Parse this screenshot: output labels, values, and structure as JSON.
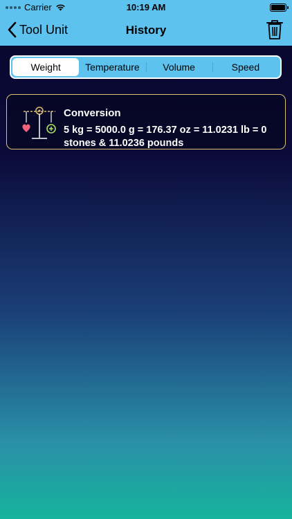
{
  "status_bar": {
    "carrier": "Carrier",
    "time": "10:19 AM"
  },
  "nav": {
    "back_label": "Tool Unit",
    "title": "History"
  },
  "segments": [
    {
      "label": "Weight",
      "selected": true
    },
    {
      "label": "Temperature",
      "selected": false
    },
    {
      "label": "Volume",
      "selected": false
    },
    {
      "label": "Speed",
      "selected": false
    }
  ],
  "history": [
    {
      "title": "Conversion",
      "text": "5 kg = 5000.0 g = 176.37 oz =  11.0231 lb = 0 stones & 11.0236 pounds",
      "icon": "scale-icon"
    }
  ],
  "colors": {
    "nav_background": "#5ec2ef",
    "card_border": "#e0c073",
    "heart": "#f0637a",
    "plus": "#a8e063"
  }
}
